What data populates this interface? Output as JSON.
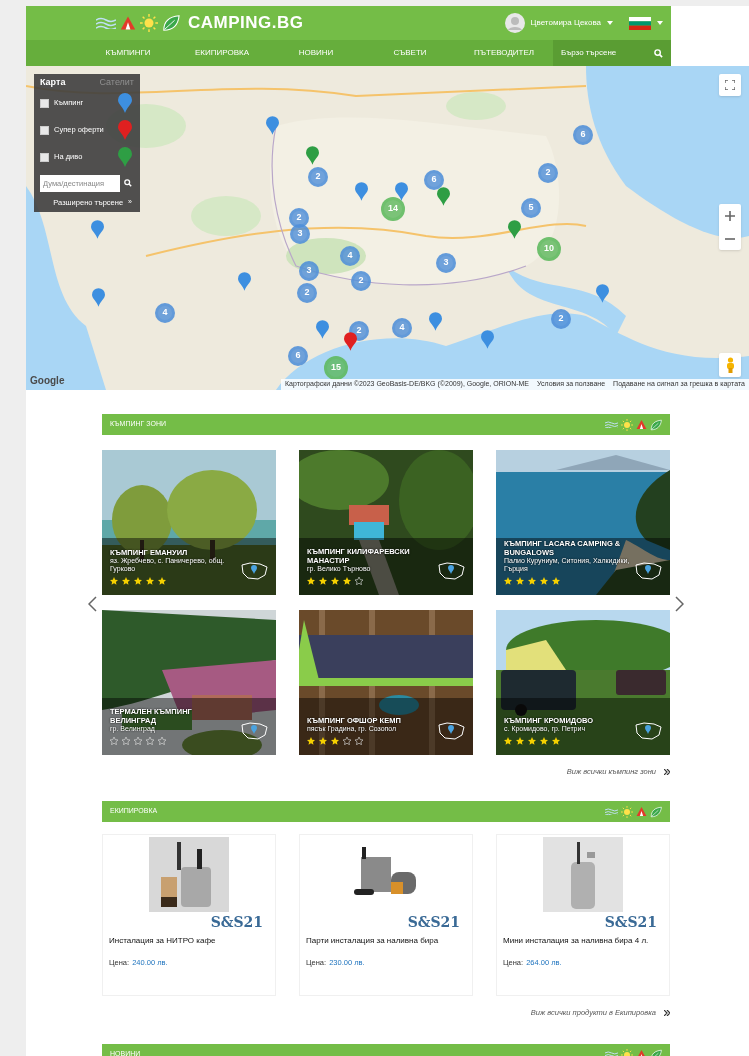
{
  "header": {
    "logo": "CAMPING.BG",
    "user": "Цветомира Цекова",
    "nav": [
      "КЪМПИНГИ",
      "ЕКИПИРОВКА",
      "НОВИНИ",
      "СЪВЕТИ",
      "ПЪТЕВОДИТЕЛ"
    ],
    "search": {
      "placeholder": "Бързо търсене"
    }
  },
  "map": {
    "tabs": [
      {
        "label": "Карта",
        "selected": true
      },
      {
        "label": "Сателит",
        "selected": false
      }
    ],
    "filters": [
      {
        "label": "Къмпинг",
        "checked": false,
        "color": "#3d8fe0"
      },
      {
        "label": "Супер оферти",
        "checked": false,
        "color": "#e02020"
      },
      {
        "label": "На диво",
        "checked": false,
        "color": "#2e9e44"
      }
    ],
    "search": {
      "placeholder": "Дума/дестинация"
    },
    "advanced_link": "Разширено търсене",
    "advanced_arrow": "»",
    "markers": [
      {
        "kind": "cluster",
        "label": "6"
      },
      {
        "kind": "cluster",
        "label": "2"
      },
      {
        "kind": "cluster",
        "label": "2"
      },
      {
        "kind": "cluster",
        "label": "6"
      },
      {
        "kind": "cluster",
        "label": "14"
      },
      {
        "kind": "cluster",
        "label": "2"
      },
      {
        "kind": "cluster",
        "label": "5"
      },
      {
        "kind": "cluster",
        "label": "3"
      },
      {
        "kind": "cluster",
        "label": "10"
      },
      {
        "kind": "cluster",
        "label": "4"
      },
      {
        "kind": "cluster",
        "label": "3"
      },
      {
        "kind": "cluster",
        "label": "3"
      },
      {
        "kind": "cluster",
        "label": "2"
      },
      {
        "kind": "cluster",
        "label": "2"
      },
      {
        "kind": "cluster",
        "label": "4"
      },
      {
        "kind": "cluster",
        "label": "2"
      },
      {
        "kind": "cluster",
        "label": "2"
      },
      {
        "kind": "cluster",
        "label": "4"
      },
      {
        "kind": "cluster",
        "label": "6"
      },
      {
        "kind": "cluster",
        "label": "15"
      },
      {
        "kind": "pin",
        "color": "#3d8fe0"
      },
      {
        "kind": "pin",
        "color": "#3d8fe0"
      },
      {
        "kind": "pin",
        "color": "#3d8fe0"
      },
      {
        "kind": "pin",
        "color": "#3d8fe0"
      },
      {
        "kind": "pin",
        "color": "#3d8fe0"
      },
      {
        "kind": "pin",
        "color": "#3d8fe0"
      },
      {
        "kind": "pin",
        "color": "#3d8fe0"
      },
      {
        "kind": "pin",
        "color": "#3d8fe0"
      },
      {
        "kind": "pin",
        "color": "#3d8fe0"
      },
      {
        "kind": "pin",
        "color": "#3d8fe0"
      },
      {
        "kind": "pin",
        "color": "#2e9e44"
      },
      {
        "kind": "pin",
        "color": "#2e9e44"
      },
      {
        "kind": "pin",
        "color": "#2e9e44"
      },
      {
        "kind": "pin",
        "color": "#e02020"
      }
    ],
    "google_logo": "Google",
    "attribution": "Картографски данни ©2023 GeoBasis-DE/BKG (©2009), Google, ORION-ME",
    "terms": "Условия за ползване",
    "report": "Подаване на сигнал за грешка в картата"
  },
  "zones": {
    "title": "КЪМПИНГ ЗОНИ",
    "cards": [
      {
        "name": "КЪМПИНГ ЕМАНУИЛ",
        "place": "яз. Жребчево, с. Паничерево, общ. Гурково",
        "stars": 5
      },
      {
        "name": "КЪМПИНГ КИЛИФАРЕВСКИ МАНАСТИР",
        "place": "гр. Велико Търново",
        "stars": 4
      },
      {
        "name": "КЪМПИНГ LACARA CAMPING & BUNGALOWS",
        "place": "Палио Куруниум, Ситония, Халкидики, Гърция",
        "stars": 5
      },
      {
        "name": "ТЕРМАЛЕН КЪМПИНГ ВЕЛИНГРАД",
        "place": "гр. Велинград",
        "stars": 0
      },
      {
        "name": "КЪМПИНГ ОФШОР КЕМП",
        "place": "пясък Градина, гр. Созопол",
        "stars": 3
      },
      {
        "name": "КЪМПИНГ КРОМИДОВО",
        "place": "с. Кромидово, гр. Петрич",
        "stars": 5
      }
    ],
    "more": "Виж всички къмпинг зони"
  },
  "equipment": {
    "title": "ЕКИПИРОВКА",
    "products": [
      {
        "brand": "S&S21",
        "name": "Инсталация за НИТРО кафе",
        "price_label": "Цена:",
        "price": "240.00 лв."
      },
      {
        "brand": "S&S21",
        "name": "Парти инсталация за наливна бира",
        "price_label": "Цена:",
        "price": "230.00 лв."
      },
      {
        "brand": "S&S21",
        "name": "Мини инсталация за наливна бира 4 л.",
        "price_label": "Цена:",
        "price": "264.00 лв."
      }
    ],
    "more": "Виж всички продукти в Екипировка"
  },
  "news": {
    "title": "НОВИНИ"
  }
}
